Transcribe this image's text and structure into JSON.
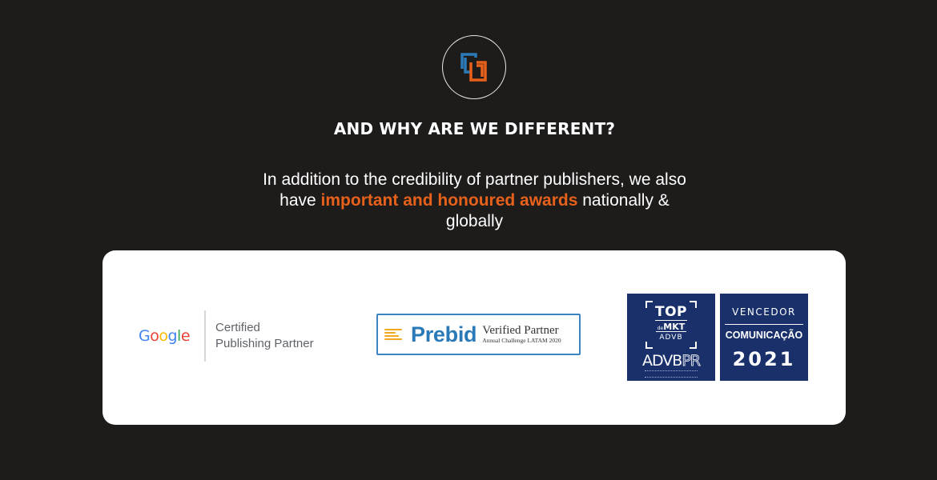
{
  "brand": {
    "logo_icon": "interlocked-squares-icon",
    "accent_blue": "#2b7bb9",
    "accent_orange": "#e8611a"
  },
  "section": {
    "heading": "AND WHY ARE WE DIFFERENT?",
    "text_before": "In addition to the credibility of partner publishers, we also have ",
    "text_highlight": "important and honoured awards",
    "text_after": " nationally & globally"
  },
  "awards": {
    "google": {
      "letters": [
        "G",
        "o",
        "o",
        "g",
        "l",
        "e"
      ],
      "line1": "Certified",
      "line2": "Publishing Partner"
    },
    "prebid": {
      "name": "Prebid",
      "title": "Verified Partner",
      "subtitle": "Annual Challenge LATAM 2020",
      "icon": "prebid-lines-icon"
    },
    "top_mkt": {
      "top": "TOP",
      "de": "de",
      "mkt": "MKT",
      "advb": "ADVB",
      "advbpr_main": "ADVB",
      "advbpr_suffix": "PR"
    },
    "vencedor": {
      "label": "VENCEDOR",
      "category": "COMUNICAÇÃO",
      "year": "2021"
    }
  },
  "colors": {
    "background": "#1e1c1b",
    "card": "#ffffff",
    "badge_navy": "#19306b",
    "prebid_blue": "#2a7ab8"
  }
}
